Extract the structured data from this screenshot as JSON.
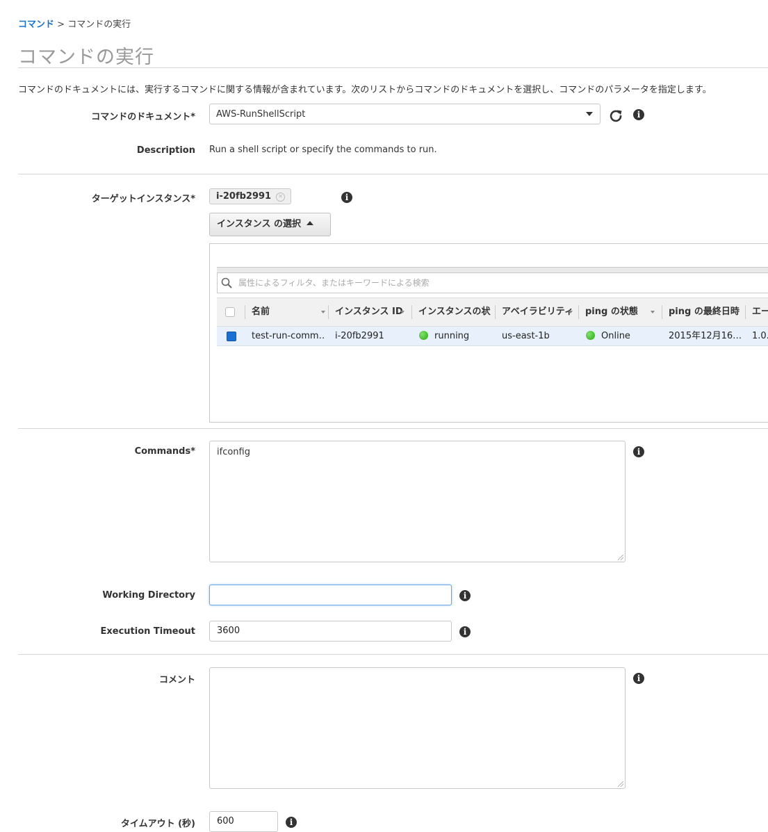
{
  "breadcrumb": {
    "root": "コマンド",
    "separator": ">",
    "current": "コマンドの実行"
  },
  "page": {
    "title": "コマンドの実行",
    "intro": "コマンドのドキュメントには、実行するコマンドに関する情報が含まれています。次のリストからコマンドのドキュメントを選択し、コマンドのパラメータを指定します。"
  },
  "document": {
    "label": "コマンドのドキュメント*",
    "value": "AWS-RunShellScript"
  },
  "description": {
    "label": "Description",
    "value": "Run a shell script or specify the commands to run."
  },
  "targets": {
    "label": "ターゲットインスタンス*",
    "chip": "i-20fb2991",
    "select_button": "インスタンス の選択",
    "filter_placeholder": "属性によるフィルタ、またはキーワードによる検索",
    "columns": [
      "名前",
      "インスタンス ID",
      "インスタンスの状態",
      "アベイラビリティ",
      "ping の状態",
      "ping の最終日時",
      "エージェントのバージョン"
    ],
    "rows": [
      {
        "name": "test-run-comm…",
        "instance_id": "i-20fb2991",
        "state": "running",
        "az": "us-east-1b",
        "ping": "Online",
        "last_ping": "2015年12月16…",
        "agent": "1.0."
      }
    ]
  },
  "commands": {
    "label": "Commands*",
    "value": "ifconfig"
  },
  "working_directory": {
    "label": "Working Directory",
    "value": ""
  },
  "execution_timeout": {
    "label": "Execution Timeout",
    "value": "3600"
  },
  "comment": {
    "label": "コメント",
    "value": ""
  },
  "timeout": {
    "label": "タイムアウト (秒)",
    "value": "600"
  },
  "icons": {
    "info": "info-icon",
    "refresh": "refresh-icon",
    "search": "search-icon"
  },
  "colors": {
    "link": "#1a73c8",
    "status_green": "#2aa615",
    "selected_row": "#e8f1fb"
  }
}
